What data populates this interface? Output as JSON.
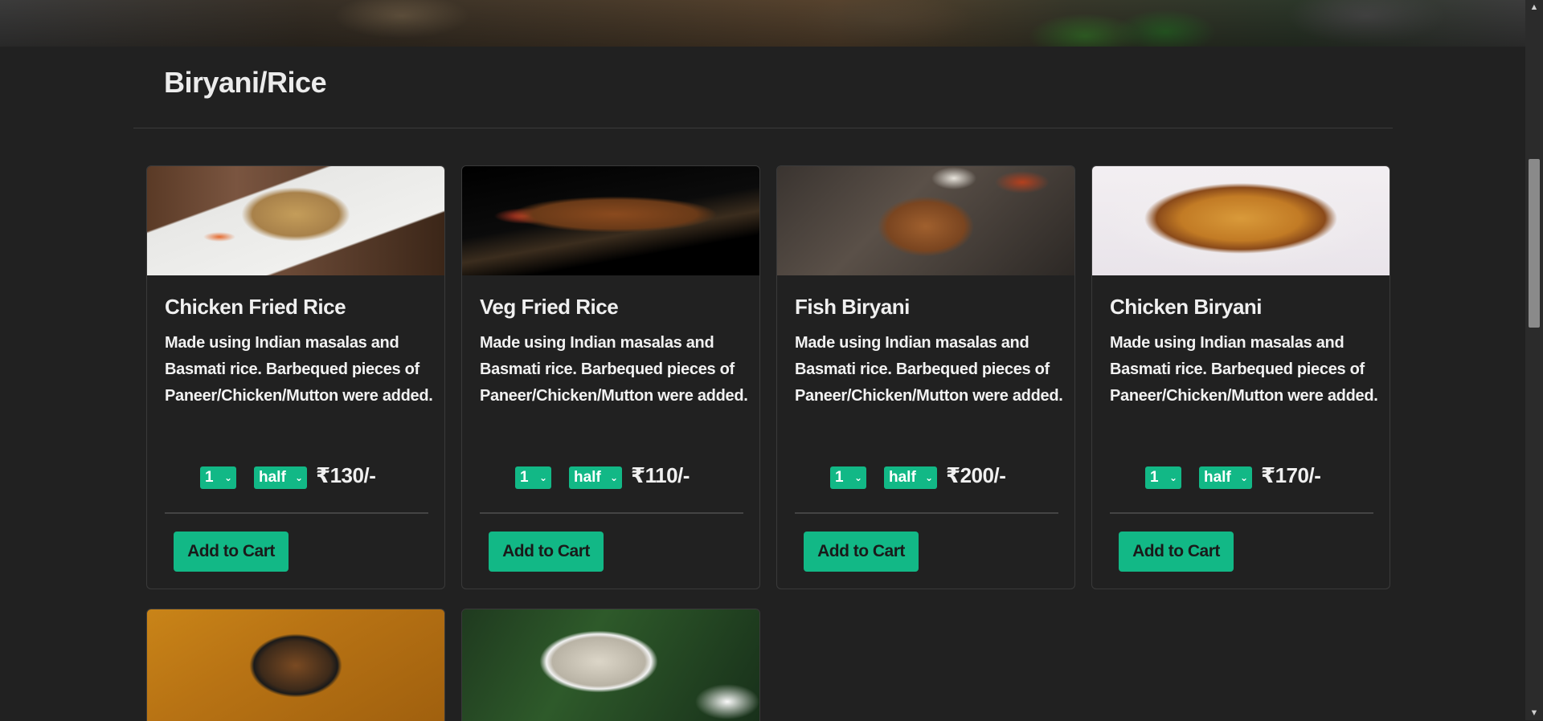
{
  "section": {
    "title": "Biryani/Rice"
  },
  "colors": {
    "background": "#212121",
    "accent": "#12b886",
    "card_border": "#3a3a3a"
  },
  "items": [
    {
      "name": "Chicken Fried Rice",
      "description": "Made using Indian masalas and Basmati rice. Barbequed pieces of Paneer/Chicken/Mutton were added.",
      "quantity": "1",
      "size": "half",
      "price": "₹130/-",
      "button": "Add to Cart",
      "image": "chicken-fried-rice-photo"
    },
    {
      "name": "Veg Fried Rice",
      "description": "Made using Indian masalas and Basmati rice. Barbequed pieces of Paneer/Chicken/Mutton were added.",
      "quantity": "1",
      "size": "half",
      "price": "₹110/-",
      "button": "Add to Cart",
      "image": "veg-fried-rice-photo"
    },
    {
      "name": "Fish Biryani",
      "description": "Made using Indian masalas and Basmati rice. Barbequed pieces of Paneer/Chicken/Mutton were added.",
      "quantity": "1",
      "size": "half",
      "price": "₹200/-",
      "button": "Add to Cart",
      "image": "fish-biryani-photo"
    },
    {
      "name": "Chicken Biryani",
      "description": "Made using Indian masalas and Basmati rice. Barbequed pieces of Paneer/Chicken/Mutton were added.",
      "quantity": "1",
      "size": "half",
      "price": "₹170/-",
      "button": "Add to Cart",
      "image": "chicken-biryani-photo"
    }
  ],
  "partial_items": [
    {
      "image": "bowl-biryani-photo"
    },
    {
      "image": "shrimp-fried-rice-photo"
    }
  ],
  "icons": {
    "select_chevron": "chevron-down-icon",
    "scroll_up": "scroll-up-arrow-icon",
    "scroll_down": "scroll-down-arrow-icon"
  }
}
